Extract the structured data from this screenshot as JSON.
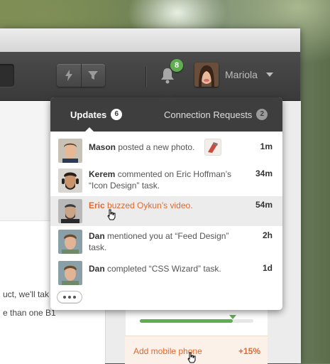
{
  "header": {
    "notification_count": "8",
    "user_name": "Mariola"
  },
  "notifications": {
    "tabs": [
      {
        "label": "Updates",
        "count": "6"
      },
      {
        "label": "Connection Requests",
        "count": "2"
      }
    ],
    "items": [
      {
        "user": "Mason",
        "text": " posted a new photo.",
        "time": "1m"
      },
      {
        "user": "Kerem",
        "text": " commented on Eric Hoffman’s “Icon Design” task.",
        "time": "34m"
      },
      {
        "user": "Eric",
        "text": " buzzed Oykun’s video.",
        "time": "54m"
      },
      {
        "user": "Dan",
        "text": " mentioned you at “Feed Design” task.",
        "time": "2h"
      },
      {
        "user": "Dan",
        "text": " completed “CSS Wizard” task.",
        "time": "1d"
      }
    ]
  },
  "background": {
    "left_text_1": "uct, we'll tak",
    "left_text_2": "e than one B1",
    "progress_level": 0.82,
    "task_label": "Add mobile phone",
    "task_percent": "+15%"
  },
  "colors": {
    "accent": "#e0682e",
    "success": "#5fae4f",
    "toolbar": "#3e3e3e"
  },
  "icons": {
    "lightning": "lightning-icon",
    "filter": "filter-icon",
    "bell": "bell-icon",
    "caret": "chevron-down-icon",
    "more": "more-icon",
    "cursor": "hand-cursor-icon"
  }
}
